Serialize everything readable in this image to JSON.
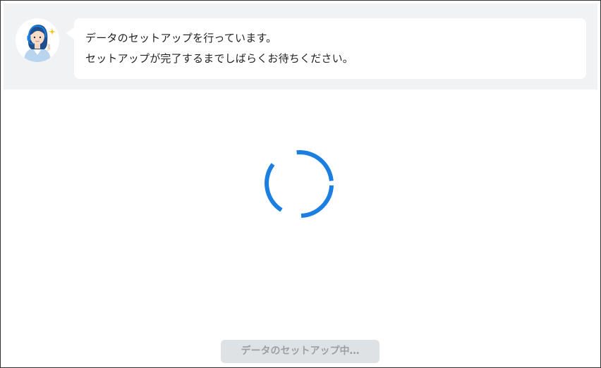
{
  "message": {
    "line1": "データのセットアップを行っています。",
    "line2": "セットアップが完了するまでしばらくお待ちください。"
  },
  "loading": {
    "icon": "spinner-icon",
    "color": "#1a7fe0"
  },
  "status_button": {
    "label": "データのセットアップ中…",
    "disabled": true
  },
  "avatar": {
    "icon": "support-agent-avatar"
  }
}
